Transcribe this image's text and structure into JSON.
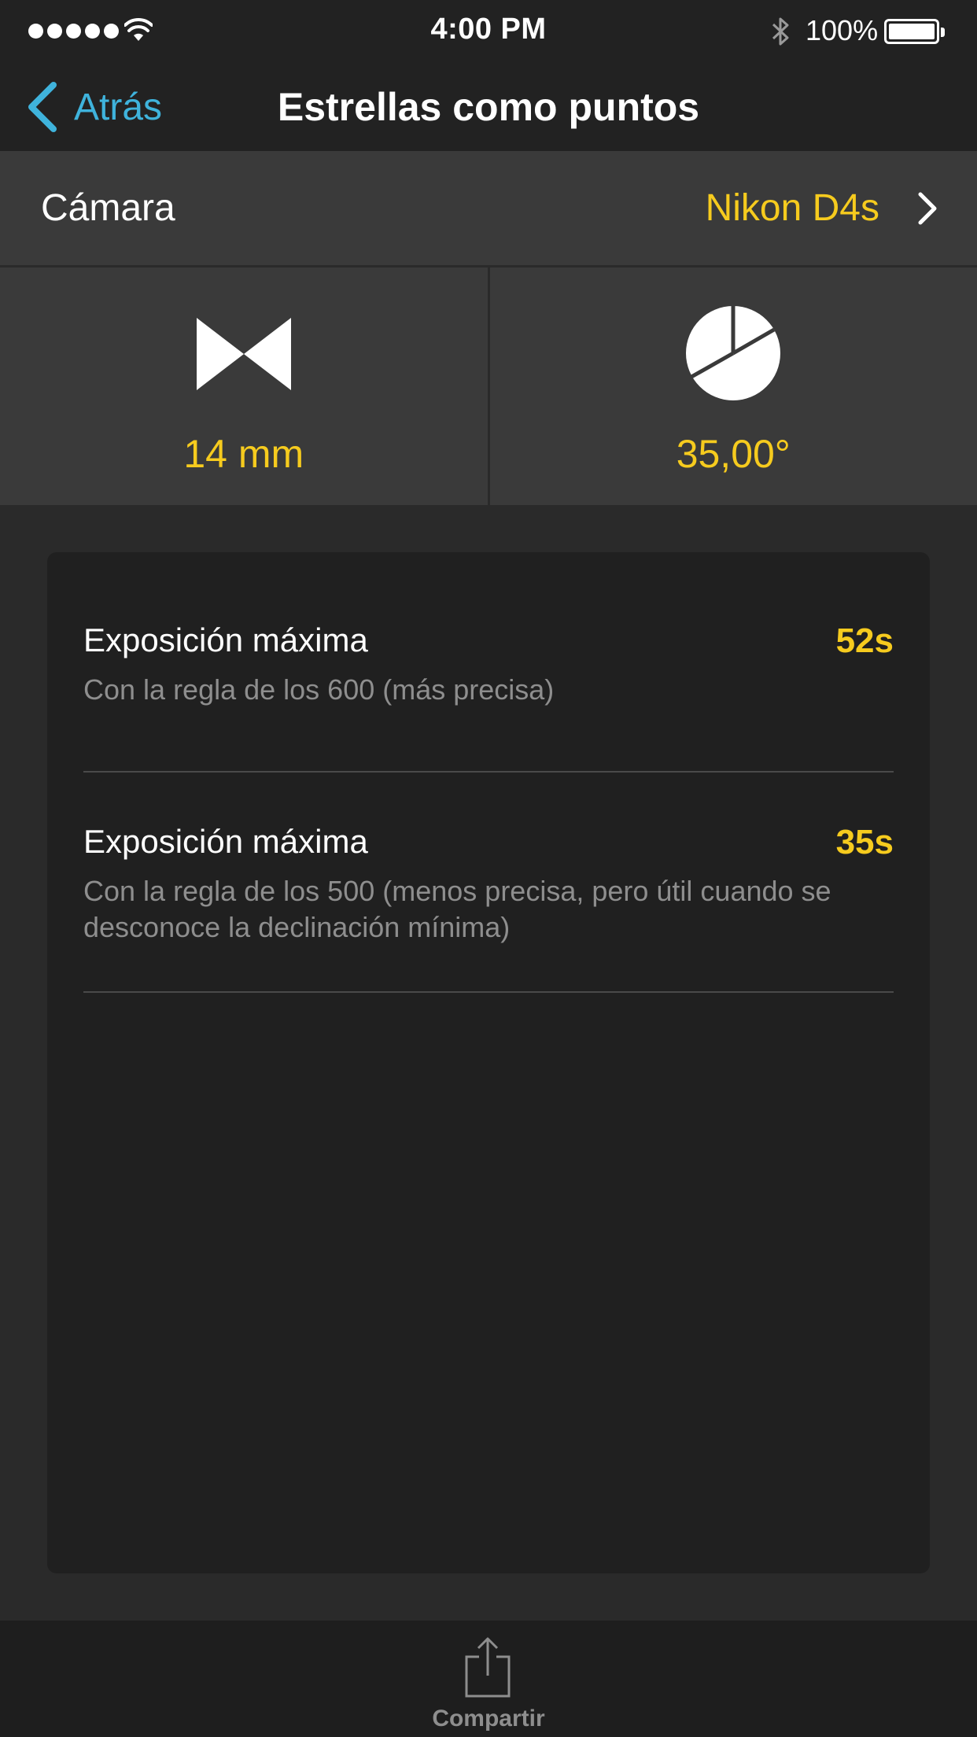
{
  "status_bar": {
    "time": "4:00 PM",
    "battery": "100%",
    "signal_icon": "signal-dots-icon",
    "wifi_icon": "wifi-icon",
    "bluetooth_icon": "bluetooth-icon",
    "battery_icon": "battery-icon"
  },
  "nav": {
    "back_label": "Atrás",
    "title": "Estrellas como puntos"
  },
  "camera": {
    "label": "Cámara",
    "value": "Nikon D4s"
  },
  "tiles": [
    {
      "icon": "focal-length-icon",
      "value": "14 mm"
    },
    {
      "icon": "declination-pie-icon",
      "value": "35,00°"
    }
  ],
  "results": [
    {
      "title": "Exposición máxima",
      "value": "52s",
      "description": "Con la regla de los 600 (más precisa)"
    },
    {
      "title": "Exposición máxima",
      "value": "35s",
      "description": "Con la regla de los 500 (menos precisa, pero útil cuando se desconoce la declinación mínima)"
    }
  ],
  "toolbar": {
    "share_label": "Compartir",
    "share_icon": "share-icon"
  },
  "colors": {
    "accent_yellow": "#f6cb1e",
    "link_blue": "#3fb3dc",
    "background": "#2a2a2a",
    "card": "#202020",
    "bar": "#222222"
  }
}
